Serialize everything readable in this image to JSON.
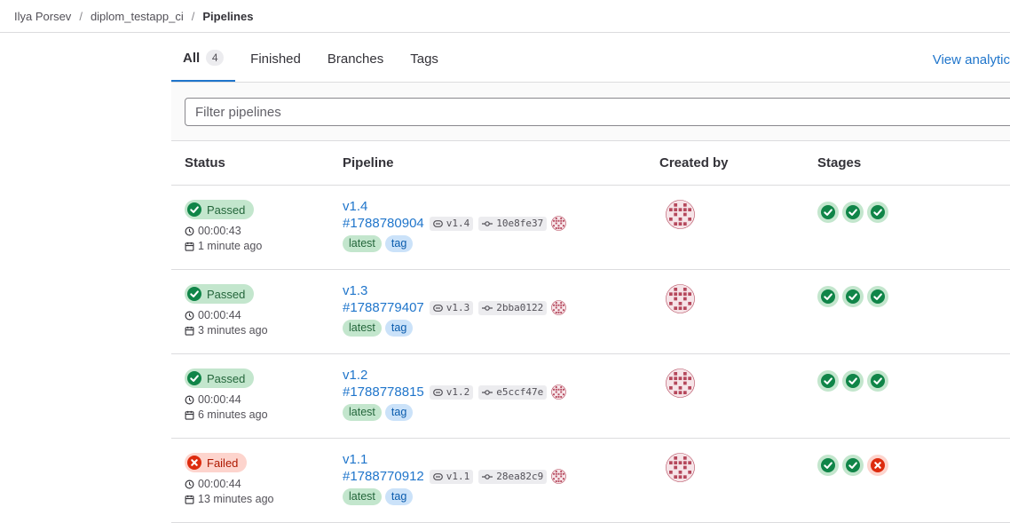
{
  "breadcrumb": {
    "items": [
      "Ilya Porsev",
      "diplom_testapp_ci",
      "Pipelines"
    ],
    "separator": "/"
  },
  "tabs": [
    {
      "label": "All",
      "count": "4"
    },
    {
      "label": "Finished"
    },
    {
      "label": "Branches"
    },
    {
      "label": "Tags"
    }
  ],
  "analytics_link": "View analytic",
  "filter": {
    "placeholder": "Filter pipelines"
  },
  "columns": [
    "Status",
    "Pipeline",
    "Created by",
    "Stages"
  ],
  "pipelines": [
    {
      "status": "Passed",
      "duration": "00:00:43",
      "time_ago": "1 minute ago",
      "name": "v1.4",
      "id": "#1788780904",
      "ref": "v1.4",
      "commit": "10e8fe37",
      "labels": [
        "latest",
        "tag"
      ]
    },
    {
      "status": "Passed",
      "duration": "00:00:44",
      "time_ago": "3 minutes ago",
      "name": "v1.3",
      "id": "#1788779407",
      "ref": "v1.3",
      "commit": "2bba0122",
      "labels": [
        "latest",
        "tag"
      ]
    },
    {
      "status": "Passed",
      "duration": "00:00:44",
      "time_ago": "6 minutes ago",
      "name": "v1.2",
      "id": "#1788778815",
      "ref": "v1.2",
      "commit": "e5ccf47e",
      "labels": [
        "latest",
        "tag"
      ]
    },
    {
      "status": "Failed",
      "duration": "00:00:44",
      "time_ago": "13 minutes ago",
      "name": "v1.1",
      "id": "#1788770912",
      "ref": "v1.1",
      "commit": "28ea82c9",
      "labels": [
        "latest",
        "tag"
      ]
    }
  ],
  "stage_statuses": [
    [
      "success",
      "success",
      "success"
    ],
    [
      "success",
      "success",
      "success"
    ],
    [
      "success",
      "success",
      "success"
    ],
    [
      "success",
      "success",
      "failed"
    ]
  ],
  "colors": {
    "success": "#108548",
    "failed": "#dd2b0e",
    "link": "#1f75cb",
    "avatar": "#b5485c"
  },
  "icons": {
    "clock": "clock-icon",
    "calendar": "calendar-icon",
    "branch": "tag-ref-icon",
    "commit": "commit-icon",
    "check": "status-success-icon",
    "fail": "status-failed-icon"
  }
}
